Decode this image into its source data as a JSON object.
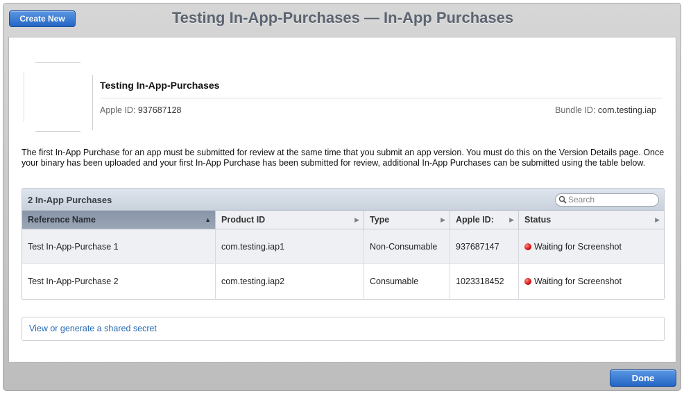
{
  "header": {
    "create_label": "Create New",
    "title": "Testing In-App-Purchases — In-App Purchases"
  },
  "app": {
    "name": "Testing In-App-Purchases",
    "apple_id_label": "Apple ID:",
    "apple_id": "937687128",
    "bundle_id_label": "Bundle ID:",
    "bundle_id": "com.testing.iap"
  },
  "note": "The first In-App Purchase for an app must be submitted for review at the same time that you submit an app version. You must do this on the Version Details page. Once your binary has been uploaded and your first In-App Purchase has been submitted for review, additional In-App Purchases can be submitted using the table below.",
  "table": {
    "title": "2 In-App Purchases",
    "search_placeholder": "Search",
    "columns": [
      "Reference Name",
      "Product ID",
      "Type",
      "Apple ID:",
      "Status"
    ],
    "rows": [
      {
        "reference_name": "Test In-App-Purchase 1",
        "product_id": "com.testing.iap1",
        "type": "Non-Consumable",
        "apple_id": "937687147",
        "status": "Waiting for Screenshot"
      },
      {
        "reference_name": "Test In-App-Purchase 2",
        "product_id": "com.testing.iap2",
        "type": "Consumable",
        "apple_id": "1023318452",
        "status": "Waiting for Screenshot"
      }
    ],
    "sorted_column": "Reference Name",
    "status_color": "#d50f0f"
  },
  "secret_link": "View or generate a shared secret",
  "footer": {
    "done_label": "Done"
  },
  "colors": {
    "accent": "#2466c4",
    "title": "#5b6470",
    "link": "#2268b4"
  }
}
